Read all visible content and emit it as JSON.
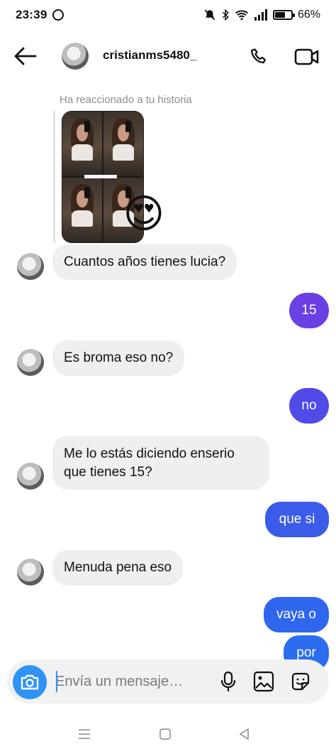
{
  "status_bar": {
    "time": "23:39",
    "battery": "66%",
    "battery_level": 0.66,
    "icons": [
      "whatsapp-icon",
      "mute-icon",
      "bluetooth-icon",
      "wifi-icon",
      "signal-icon",
      "battery-icon"
    ]
  },
  "header": {
    "username": "cristianms5480_",
    "icons": [
      "back-arrow-icon",
      "phone-icon",
      "video-camera-icon"
    ]
  },
  "story_reaction": {
    "caption": "Ha reaccionado a tu historia",
    "emoji": "😍"
  },
  "messages": [
    {
      "direction": "in",
      "text": "Cuantos años tienes lucia?"
    },
    {
      "direction": "out",
      "text": "15"
    },
    {
      "direction": "in",
      "text": "Es broma eso no?"
    },
    {
      "direction": "out",
      "text": "no"
    },
    {
      "direction": "in",
      "text": "Me lo estás diciendo enserio que tienes 15?"
    },
    {
      "direction": "out",
      "text": "que si"
    },
    {
      "direction": "in",
      "text": "Menuda pena eso"
    },
    {
      "direction": "out",
      "text": "vaya o"
    },
    {
      "direction": "out",
      "text": "por"
    }
  ],
  "composer": {
    "placeholder": "Envía un mensaje…",
    "icons": [
      "camera-icon",
      "microphone-icon",
      "gallery-icon",
      "sticker-icon"
    ]
  },
  "colors": {
    "outgoing_start": "#7b3fe0",
    "outgoing_end": "#2b6cf0",
    "incoming": "#efefef",
    "camera_button": "#2f93f5"
  }
}
